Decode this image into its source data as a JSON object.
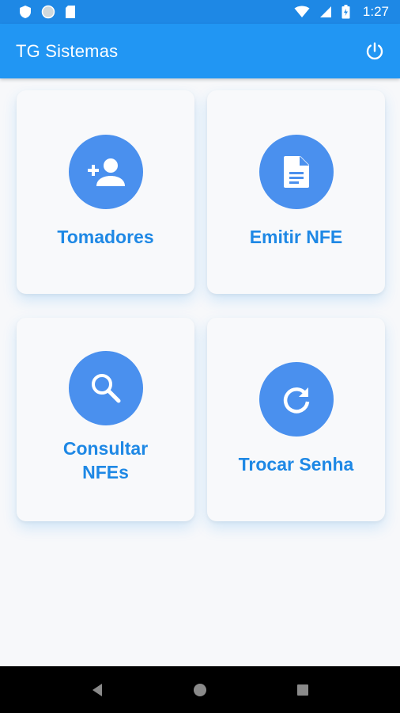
{
  "status_bar": {
    "time": "1:27",
    "icons": [
      "shield-icon",
      "circle-icon",
      "sd-card-icon",
      "wifi-icon",
      "signal-icon",
      "battery-icon"
    ]
  },
  "app_bar": {
    "title": "TG Sistemas",
    "action_icon": "power-icon"
  },
  "cards": [
    {
      "label": "Tomadores",
      "icon": "person-add-icon"
    },
    {
      "label": "Emitir NFE",
      "icon": "document-icon"
    },
    {
      "label_lines": [
        "Consultar",
        "NFEs"
      ],
      "icon": "search-icon"
    },
    {
      "label": "Trocar Senha",
      "icon": "refresh-icon"
    }
  ],
  "nav_bar": {
    "icons": [
      "back-icon",
      "home-icon",
      "recents-icon"
    ]
  },
  "colors": {
    "status_bar": "#1e88e5",
    "app_bar": "#2196f3",
    "accent": "#1e88e5",
    "icon_circle": "#4a90ee",
    "background": "#f7f8fa"
  }
}
